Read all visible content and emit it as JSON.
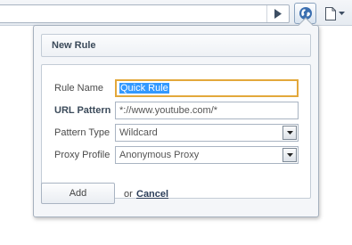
{
  "popup": {
    "title": "New Rule"
  },
  "form": {
    "rule_name_label": "Rule Name",
    "rule_name_value": "Quick Rule",
    "url_pattern_label": "URL Pattern",
    "url_pattern_value": "*://www.youtube.com/*",
    "pattern_type_label": "Pattern Type",
    "pattern_type_selected": "Wildcard",
    "proxy_profile_label": "Proxy Profile",
    "proxy_profile_selected": "Anonymous Proxy"
  },
  "actions": {
    "add_label": "Add",
    "or_text": "or",
    "cancel_label": "Cancel"
  },
  "icons": {
    "go": "play-arrow-icon",
    "proxy": "globe-icon",
    "page_menu": "page-icon"
  },
  "colors": {
    "focus_border": "#e3a83b",
    "selection": "#3399ff",
    "globe": "#3b6fb0"
  }
}
